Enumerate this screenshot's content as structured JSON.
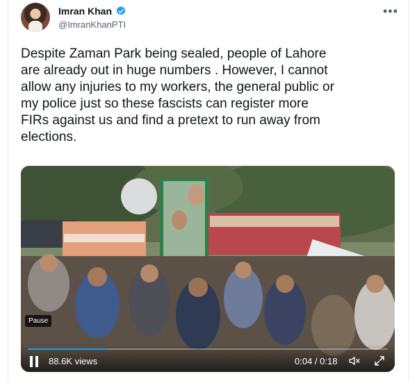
{
  "author": {
    "name": "Imran Khan",
    "handle": "@ImranKhanPTI",
    "verified": true
  },
  "tweet": {
    "text_lines": [
      "Despite Zaman Park being sealed, people of Lahore",
      "are already out in huge numbers . However, I cannot",
      "allow any injuries to my workers, the general public or",
      "my police just so these fascists can register more",
      "FIRs against us and find a pretext to run away from",
      "elections."
    ]
  },
  "video": {
    "pause_tooltip": "Pause",
    "views": "88.6K views",
    "time": "0:04 / 0:18",
    "progress": 0.22
  },
  "icons": {
    "verified": "verified-badge-icon",
    "more": "more-icon",
    "pause": "pause-icon",
    "mute": "speaker-muted-icon",
    "fullscreen": "fullscreen-icon"
  },
  "colors": {
    "accent": "#1d9bf0",
    "text": "#0f1419",
    "secondary": "#536471"
  }
}
